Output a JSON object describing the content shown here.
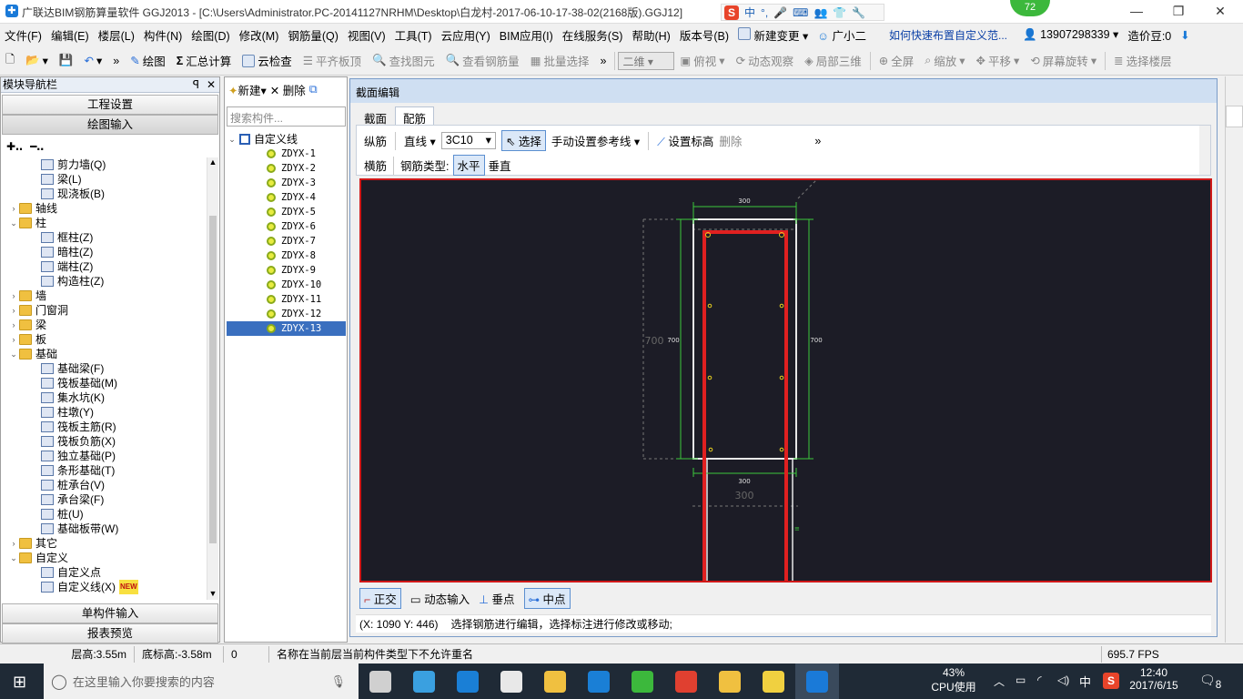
{
  "window": {
    "title": "广联达BIM钢筋算量软件 GGJ2013 - [C:\\Users\\Administrator.PC-20141127NRHM\\Desktop\\白龙村-2017-06-10-17-38-02(2168版).GGJ12]",
    "badge": "72",
    "minimize": "—",
    "restore": "❐",
    "close": "✕"
  },
  "ime": {
    "items": [
      "S",
      "中",
      "°,",
      "🎤",
      "⌨",
      "👥",
      "👕",
      "🔧"
    ]
  },
  "menu": {
    "items": [
      "文件(F)",
      "编辑(E)",
      "楼层(L)",
      "构件(N)",
      "绘图(D)",
      "修改(M)",
      "钢筋量(Q)",
      "视图(V)",
      "工具(T)",
      "云应用(Y)",
      "BIM应用(I)",
      "在线服务(S)",
      "帮助(H)",
      "版本号(B)"
    ],
    "new_change": "新建变更",
    "assistant": "广小二",
    "link": "如何快速布置自定义范...",
    "phone": "13907298339",
    "price": "造价豆:0"
  },
  "toolbar": {
    "draw": "绘图",
    "sum": "汇总计算",
    "cloud_check": "云检查",
    "align_top": "平齐板顶",
    "find": "查找图元",
    "view_rebar": "查看钢筋量",
    "batch_select": "批量选择",
    "view_mode": "二维",
    "top_view": "俯视",
    "dynamic": "动态观察",
    "local3d": "局部三维",
    "fullscreen": "全屏",
    "zoom": "缩放",
    "pan": "平移",
    "rotate": "屏幕旋转",
    "select_floor": "选择楼层"
  },
  "left_panel": {
    "title": "模块导航栏",
    "pin": "ꟼ",
    "close": "✕",
    "project_settings": "工程设置",
    "draw_input": "绘图输入",
    "single_input": "单构件输入",
    "report": "报表预览",
    "tree": [
      {
        "level": 2,
        "label": "剪力墙(Q)",
        "type": "item"
      },
      {
        "level": 2,
        "label": "梁(L)",
        "type": "item"
      },
      {
        "level": 2,
        "label": "现浇板(B)",
        "type": "item"
      },
      {
        "level": 1,
        "label": "轴线",
        "type": "folder",
        "exp": "›"
      },
      {
        "level": 1,
        "label": "柱",
        "type": "folder",
        "exp": "⌄"
      },
      {
        "level": 2,
        "label": "框柱(Z)",
        "type": "item"
      },
      {
        "level": 2,
        "label": "暗柱(Z)",
        "type": "item"
      },
      {
        "level": 2,
        "label": "端柱(Z)",
        "type": "item"
      },
      {
        "level": 2,
        "label": "构造柱(Z)",
        "type": "item"
      },
      {
        "level": 1,
        "label": "墙",
        "type": "folder",
        "exp": "›"
      },
      {
        "level": 1,
        "label": "门窗洞",
        "type": "folder",
        "exp": "›"
      },
      {
        "level": 1,
        "label": "梁",
        "type": "folder",
        "exp": "›"
      },
      {
        "level": 1,
        "label": "板",
        "type": "folder",
        "exp": "›"
      },
      {
        "level": 1,
        "label": "基础",
        "type": "folder",
        "exp": "⌄"
      },
      {
        "level": 2,
        "label": "基础梁(F)",
        "type": "item"
      },
      {
        "level": 2,
        "label": "筏板基础(M)",
        "type": "item"
      },
      {
        "level": 2,
        "label": "集水坑(K)",
        "type": "item"
      },
      {
        "level": 2,
        "label": "柱墩(Y)",
        "type": "item"
      },
      {
        "level": 2,
        "label": "筏板主筋(R)",
        "type": "item"
      },
      {
        "level": 2,
        "label": "筏板负筋(X)",
        "type": "item"
      },
      {
        "level": 2,
        "label": "独立基础(P)",
        "type": "item"
      },
      {
        "level": 2,
        "label": "条形基础(T)",
        "type": "item"
      },
      {
        "level": 2,
        "label": "桩承台(V)",
        "type": "item"
      },
      {
        "level": 2,
        "label": "承台梁(F)",
        "type": "item"
      },
      {
        "level": 2,
        "label": "桩(U)",
        "type": "item"
      },
      {
        "level": 2,
        "label": "基础板带(W)",
        "type": "item"
      },
      {
        "level": 1,
        "label": "其它",
        "type": "folder",
        "exp": "›"
      },
      {
        "level": 1,
        "label": "自定义",
        "type": "folder",
        "exp": "⌄"
      },
      {
        "level": 2,
        "label": "自定义点",
        "type": "item"
      },
      {
        "level": 2,
        "label": "自定义线(X)",
        "type": "item",
        "new": "NEW"
      }
    ]
  },
  "mid_panel": {
    "new": "新建",
    "delete": "删除",
    "search_placeholder": "搜索构件...",
    "root": "自定义线",
    "items": [
      "ZDYX-1",
      "ZDYX-2",
      "ZDYX-3",
      "ZDYX-4",
      "ZDYX-5",
      "ZDYX-6",
      "ZDYX-7",
      "ZDYX-8",
      "ZDYX-9",
      "ZDYX-10",
      "ZDYX-11",
      "ZDYX-12",
      "ZDYX-13"
    ],
    "selected_index": 12
  },
  "dialog": {
    "title": "截面编辑",
    "tabs": [
      "截面",
      "配筋"
    ],
    "active_tab": 1,
    "row1": {
      "longitudinal": "纵筋",
      "line_type": "直线",
      "spec": "3C10",
      "select": "选择",
      "manual_ref": "手动设置参考线",
      "set_dim": "设置标高",
      "delete": "删除"
    },
    "row2": {
      "transverse": "横筋",
      "rebar_type_label": "钢筋类型:",
      "horizontal": "水平",
      "vertical": "垂直"
    },
    "canvas": {
      "dim_top": "300",
      "dim_bottom": "300",
      "dim_bottom_large": "300",
      "dim_left": "700",
      "dim_left_large": "700",
      "dim_right": "700"
    },
    "bottom": {
      "ortho": "正交",
      "dynamic_input": "动态输入",
      "perpendicular": "垂点",
      "midpoint": "中点"
    },
    "coords": "(X: 1090 Y: 446)",
    "hint": "选择钢筋进行编辑，选择标注进行修改或移动;"
  },
  "statusbar": {
    "floor_height": "层高:3.55m",
    "base_elev": "底标高:-3.58m",
    "zero": "0",
    "message": "名称在当前层当前构件类型下不允许重名",
    "fps": "695.7 FPS"
  },
  "taskbar": {
    "search_placeholder": "在这里输入你要搜索的内容",
    "cpu_pct": "43%",
    "cpu_label": "CPU使用",
    "lang": "中",
    "time": "12:40",
    "date": "2017/6/15",
    "notif": "8",
    "apps": [
      {
        "name": "app-icon-1",
        "color": "#d0d0d0"
      },
      {
        "name": "app-icon-2",
        "color": "#3aa0e0"
      },
      {
        "name": "edge-icon",
        "color": "#1a7fd6"
      },
      {
        "name": "store-icon",
        "color": "#e8e8e8"
      },
      {
        "name": "explorer-icon",
        "color": "#f0c040"
      },
      {
        "name": "glodon-icon",
        "color": "#1a7fd6"
      },
      {
        "name": "browser-icon",
        "color": "#3cb83c"
      },
      {
        "name": "app-icon-8",
        "color": "#e04030"
      },
      {
        "name": "notepad-icon",
        "color": "#f0c040"
      },
      {
        "name": "help-icon",
        "color": "#f0d040"
      },
      {
        "name": "ggj-icon",
        "color": "#1a7ad8"
      }
    ]
  }
}
